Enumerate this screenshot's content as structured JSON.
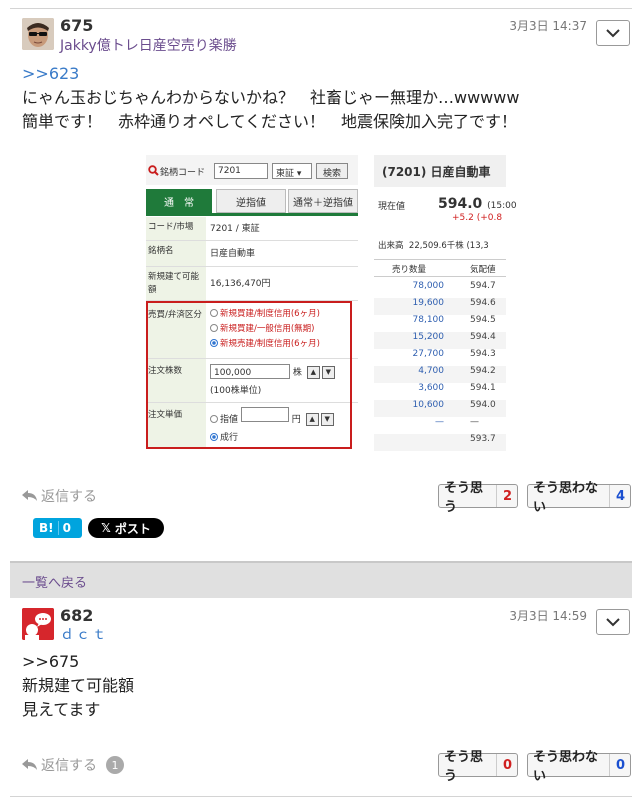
{
  "post1": {
    "number": "675",
    "username": "Jakky億トレ日産空売り楽勝",
    "timestamp": "3月3日 14:37",
    "anchor": ">>623",
    "lines": [
      "にゃん玉おじちゃんわからないかね？　社畜じゃー無理か…wwwww",
      "簡単です！　赤枠通りオペしてください！　地震保険加入完了です！"
    ],
    "reply_label": "返信する",
    "vote_yes_label": "そう思う",
    "vote_yes_count": "2",
    "vote_no_label": "そう思わない",
    "vote_no_count": "4",
    "hatena_label": "B!",
    "hatena_count": "0",
    "x_post_label": "ポスト"
  },
  "embedded_shot": {
    "left": {
      "search_label": "銘柄コード",
      "search_value": "7201",
      "market_select": "東証",
      "search_button": "検索",
      "tabs": [
        "通　常",
        "逆指値",
        "通常＋逆指値"
      ],
      "rows": [
        {
          "key": "コード/市場",
          "value": "7201 / 東証"
        },
        {
          "key": "銘柄名",
          "value": "日産自動車"
        },
        {
          "key": "新規建て可能額",
          "value": "16,136,470円"
        }
      ],
      "trade_type_key": "売買/弁済区分",
      "trade_options": [
        "新規買建/制度信用(6ヶ月)",
        "新規買建/一般信用(無期)",
        "新規売建/制度信用(6ヶ月)"
      ],
      "qty_key": "注文株数",
      "qty_value": "100,000",
      "qty_unit": "株",
      "qty_note": "(100株単位)",
      "price_key": "注文単価",
      "price_opt_limit": "指値",
      "price_unit": "円",
      "price_opt_market": "成行"
    },
    "right": {
      "title": "(7201) 日産自動車",
      "current_label": "現在値",
      "current_price": "594.0",
      "current_time": "(15:00",
      "change": "+5.2 (+0.8",
      "volume_label": "出来高",
      "volume_value": "22,509.6千株 (13,3",
      "col_qty": "売り数量",
      "col_price": "気配値",
      "orderbook": [
        {
          "q": "78,000",
          "p": "594.7"
        },
        {
          "q": "19,600",
          "p": "594.6"
        },
        {
          "q": "78,100",
          "p": "594.5"
        },
        {
          "q": "15,200",
          "p": "594.4"
        },
        {
          "q": "27,700",
          "p": "594.3"
        },
        {
          "q": "4,700",
          "p": "594.2"
        },
        {
          "q": "3,600",
          "p": "594.1"
        },
        {
          "q": "10,600",
          "p": "594.0"
        },
        {
          "q": "—",
          "p": "—"
        },
        {
          "q": "",
          "p": "593.7"
        }
      ]
    }
  },
  "back_link": "一覧へ戻る",
  "post2": {
    "number": "682",
    "username": "ｄｃｔ",
    "timestamp": "3月3日 14:59",
    "anchor": ">>675",
    "lines": [
      "新規建て可能額",
      "見えてます"
    ],
    "reply_label": "返信する",
    "reply_count": "1",
    "vote_yes_label": "そう思う",
    "vote_yes_count": "0",
    "vote_no_label": "そう思わない",
    "vote_no_count": "0"
  }
}
